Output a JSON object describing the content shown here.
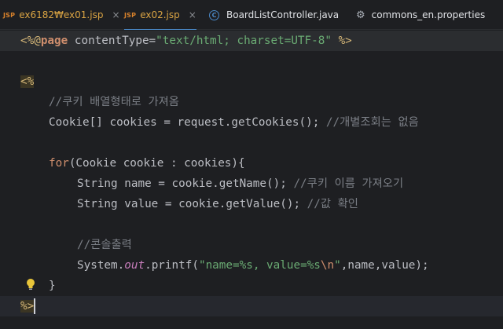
{
  "tabs": [
    {
      "icon": "JSP",
      "label": "ex6182₩ex01.jsp",
      "close": "×"
    },
    {
      "icon": "JSP",
      "label": "ex02.jsp",
      "close": "×"
    },
    {
      "icon": "C",
      "label": "BoardListController.java"
    },
    {
      "icon": "gear-icon",
      "label": "commons_en.properties"
    }
  ],
  "code": {
    "line1": {
      "open": "<%@",
      "kw": "page",
      "attr": " contentType=",
      "val": "\"text/html; charset=UTF-8\"",
      "close": " %>"
    },
    "line3": {
      "open": "<%"
    },
    "line4": {
      "comment": "//쿠키 배열형태로 가져옴"
    },
    "line5": {
      "text": "Cookie[] cookies = request.getCookies(); ",
      "comment": "//개별조회는 없음"
    },
    "line7": {
      "kw": "for",
      "text": "(Cookie cookie : cookies){"
    },
    "line8": {
      "text": "String name = cookie.getName(); ",
      "comment": "//쿠키 이름 가져오기"
    },
    "line9": {
      "text": "String value = cookie.getValue(); ",
      "comment": "//값 확인"
    },
    "line11": {
      "comment": "//콘솔출력"
    },
    "line12": {
      "a": "System.",
      "field": "out",
      "b": ".printf(",
      "str1": "\"name=%s, value=%s",
      "esc": "\\n",
      "str2": "\"",
      "c": ",name,value);"
    },
    "line13": {
      "text": "}"
    },
    "line14": {
      "close": "%>"
    }
  }
}
